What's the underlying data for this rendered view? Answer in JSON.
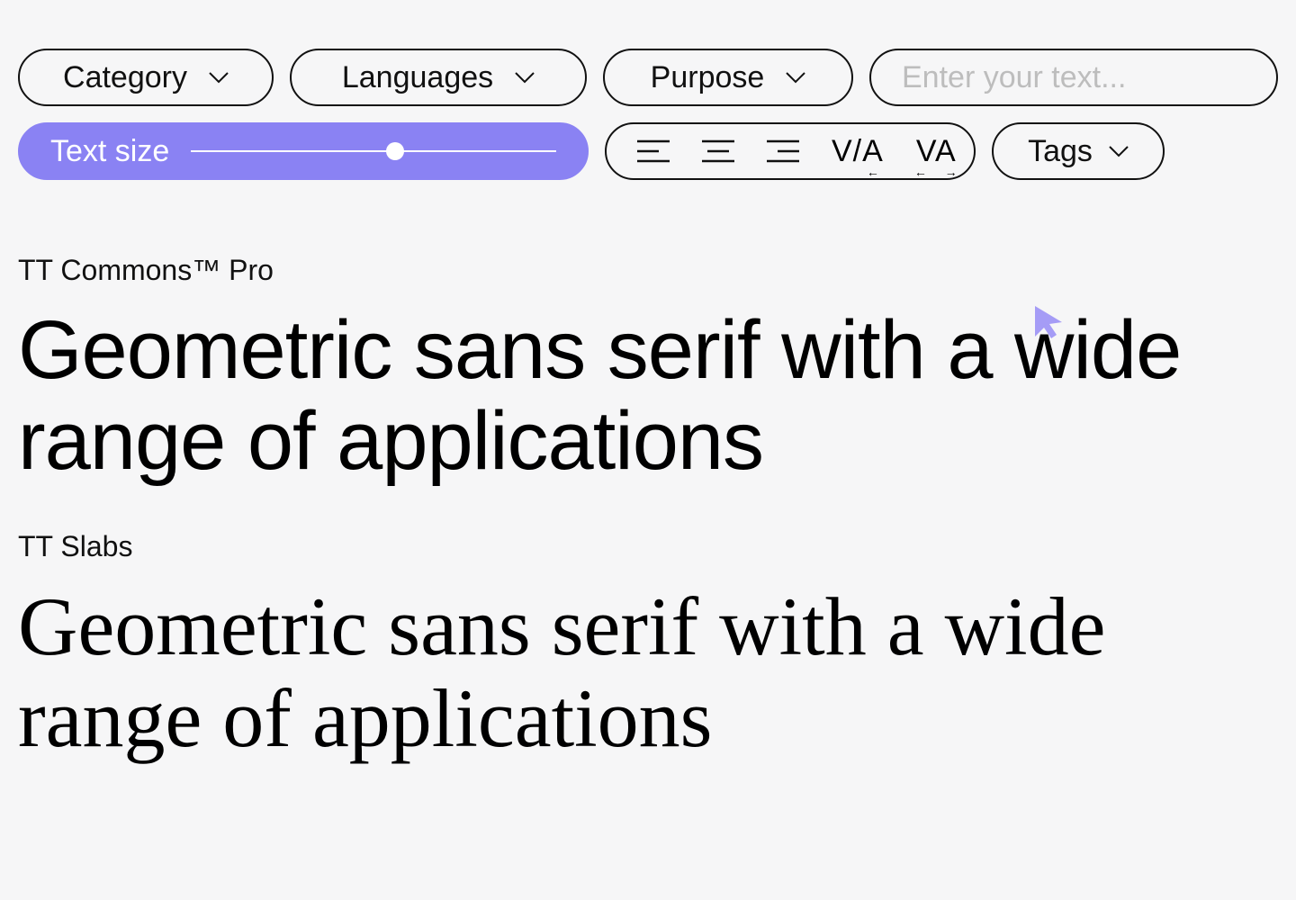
{
  "filters": {
    "category_label": "Category",
    "languages_label": "Languages",
    "purpose_label": "Purpose",
    "tags_label": "Tags"
  },
  "search": {
    "placeholder": "Enter your text...",
    "value": ""
  },
  "slider": {
    "label": "Text size",
    "value_percent": 56
  },
  "toolbar": {
    "align_left": "align-left",
    "align_center": "align-center",
    "align_right": "align-right",
    "kerning_tight": "V/A",
    "kerning_wide": "VA"
  },
  "fonts": [
    {
      "name": "TT Commons™ Pro",
      "sample": "Geometric sans serif with a wide range of applications",
      "style": "sans"
    },
    {
      "name": "TT Slabs",
      "sample": "Geometric sans serif with a wide range of applications",
      "style": "slab"
    }
  ],
  "colors": {
    "accent": "#8a82f3",
    "background": "#f6f6f7",
    "text": "#111111",
    "placeholder": "#bdbdbd"
  }
}
